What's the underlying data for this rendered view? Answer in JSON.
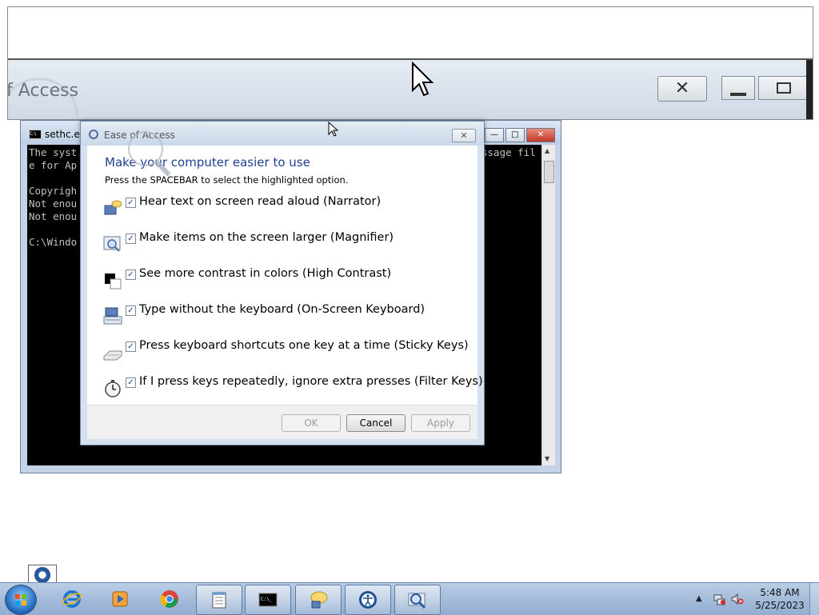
{
  "magnifier": {
    "title_fragment": "f Access",
    "close_glyph": "✕"
  },
  "console": {
    "title": "sethc.exe",
    "lines": [
      "The syst",
      "e for Ap",
      "",
      "Copyrigh",
      "Not enou",
      "Not enou",
      "",
      "C:\\Windo"
    ],
    "right_fragment": "ssage fil",
    "min_glyph": "—",
    "max_glyph": "□",
    "close_glyph": "✕"
  },
  "dialog": {
    "title": "Ease of Access",
    "close_glyph": "✕",
    "heading": "Make your computer easier to use",
    "instruction": "Press the SPACEBAR to select the highlighted option.",
    "options": [
      {
        "label": "Hear text on screen read aloud (Narrator)",
        "checked": true,
        "icon": "narrator-icon"
      },
      {
        "label": "Make items on the screen larger (Magnifier)",
        "checked": true,
        "icon": "magnifier-icon"
      },
      {
        "label": "See more contrast in colors (High Contrast)",
        "checked": true,
        "icon": "high-contrast-icon"
      },
      {
        "label": "Type without the keyboard (On-Screen Keyboard)",
        "checked": true,
        "icon": "onscreen-keyboard-icon"
      },
      {
        "label": "Press keyboard shortcuts one key at a time (Sticky Keys)",
        "checked": true,
        "icon": "sticky-keys-icon"
      },
      {
        "label": "If I press keys repeatedly, ignore extra presses (Filter Keys)",
        "checked": true,
        "icon": "filter-keys-icon"
      }
    ],
    "check_glyph": "✓",
    "buttons": {
      "ok": "OK",
      "cancel": "Cancel",
      "apply": "Apply"
    }
  },
  "taskbar": {
    "pinned": [
      {
        "name": "internet-explorer-icon"
      },
      {
        "name": "media-player-icon"
      },
      {
        "name": "chrome-icon"
      },
      {
        "name": "notepad-icon"
      },
      {
        "name": "cmd-icon"
      },
      {
        "name": "narrator-icon"
      },
      {
        "name": "ease-of-access-icon"
      },
      {
        "name": "magnifier-icon"
      }
    ],
    "tray_chevron": "▲",
    "clock": {
      "time": "5:48 AM",
      "date": "5/25/2023"
    }
  }
}
